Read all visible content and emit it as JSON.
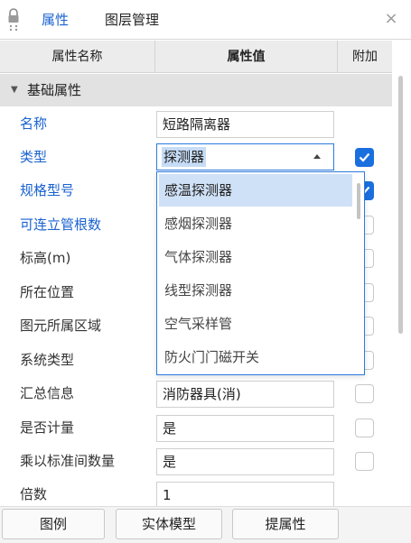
{
  "tabs": [
    {
      "label": "属性",
      "active": true
    },
    {
      "label": "图层管理",
      "active": false
    }
  ],
  "columns": {
    "name": "属性名称",
    "value": "属性值",
    "extra": "附加"
  },
  "group": {
    "label": "基础属性"
  },
  "rows": [
    {
      "label": "名称",
      "value": "短路隔离器",
      "checkbox": null
    },
    {
      "label": "类型",
      "value": "探测器",
      "checkbox": true
    },
    {
      "label": "规格型号",
      "value": "",
      "checkbox": true
    },
    {
      "label": "可连立管根数",
      "value": "",
      "checkbox": false
    },
    {
      "label": "标高(m)",
      "value": "",
      "checkbox": false
    },
    {
      "label": "所在位置",
      "value": "",
      "checkbox": false
    },
    {
      "label": "图元所属区域",
      "value": "",
      "checkbox": false
    },
    {
      "label": "系统类型",
      "value": "",
      "checkbox": false
    },
    {
      "label": "汇总信息",
      "value": "消防器具(消)",
      "checkbox": false
    },
    {
      "label": "是否计量",
      "value": "是",
      "checkbox": false
    },
    {
      "label": "乘以标准间数量",
      "value": "是",
      "checkbox": false
    },
    {
      "label": "倍数",
      "value": "1",
      "checkbox": null
    }
  ],
  "dropdown": {
    "options": [
      "感温探测器",
      "感烟探测器",
      "气体探测器",
      "线型探测器",
      "空气采样管",
      "防火门门磁开关"
    ],
    "selected_index": 0
  },
  "buttons": {
    "legend": "图例",
    "solid_model": "实体模型",
    "extract_props": "提属性"
  },
  "colors": {
    "accent": "#1a6fde",
    "link_label": "#1a62d0",
    "header_bg": "#ececec",
    "group_bg": "#e2e2e2",
    "selected_option": "#cfe1f7"
  }
}
